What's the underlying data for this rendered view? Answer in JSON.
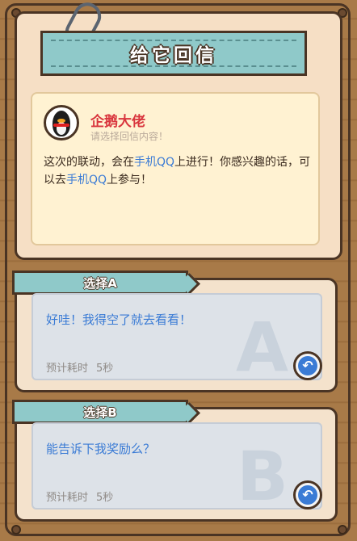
{
  "header": {
    "title": "给它回信"
  },
  "letter": {
    "sender": "企鹅大佬",
    "hint": "请选择回信内容！",
    "body_part1": "这次的联动，会在",
    "body_highlight1": "手机QQ",
    "body_part2": "上进行！你感兴趣的话，可以去",
    "body_highlight2": "手机QQ",
    "body_part3": "上参与！"
  },
  "options": [
    {
      "tag": "选择A",
      "letter": "A",
      "text": "好哇！我得空了就去看看！",
      "time_label": "预计耗时",
      "time_value": "5秒"
    },
    {
      "tag": "选择B",
      "letter": "B",
      "text": "能告诉下我奖励么？",
      "time_label": "预计耗时",
      "time_value": "5秒"
    }
  ],
  "colors": {
    "accent_blue": "#3a7bd5",
    "sender_red": "#d9363e",
    "ribbon_teal": "#8fc9c9"
  }
}
